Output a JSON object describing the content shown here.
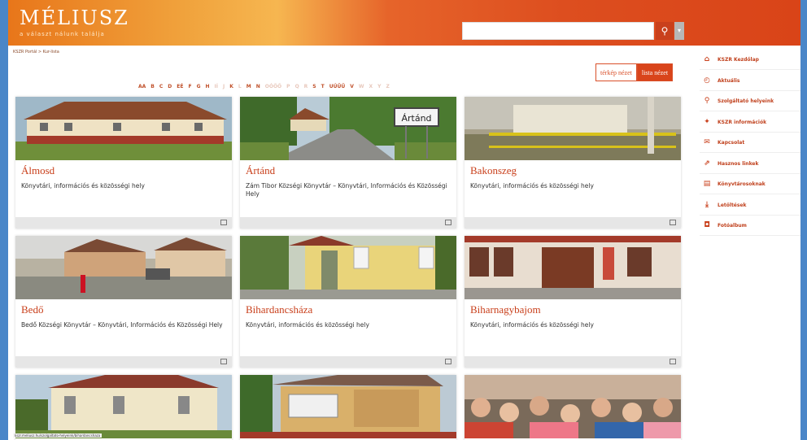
{
  "header": {
    "logo_title": "MÉLIUSZ",
    "logo_subtitle": "a választ nálunk találja",
    "search_placeholder": "",
    "search_icon": "search-icon",
    "dropdown_icon": "chevron-down-icon"
  },
  "breadcrumb": "KSZR Portál > Kur-lista",
  "view_toggle": {
    "map": "térkép nézet",
    "list": "lista nézet"
  },
  "alphabet": [
    {
      "l": "AA",
      "on": true
    },
    {
      "l": "B",
      "on": true
    },
    {
      "l": "C",
      "on": true
    },
    {
      "l": "D",
      "on": true
    },
    {
      "l": "EÉ",
      "on": true
    },
    {
      "l": "F",
      "on": true
    },
    {
      "l": "G",
      "on": true
    },
    {
      "l": "H",
      "on": true
    },
    {
      "l": "IÍ",
      "on": false
    },
    {
      "l": "J",
      "on": false
    },
    {
      "l": "K",
      "on": true
    },
    {
      "l": "L",
      "on": false
    },
    {
      "l": "M",
      "on": true
    },
    {
      "l": "N",
      "on": true
    },
    {
      "l": "OÓÖŐ",
      "on": false
    },
    {
      "l": "P",
      "on": false
    },
    {
      "l": "Q",
      "on": false
    },
    {
      "l": "R",
      "on": false
    },
    {
      "l": "S",
      "on": true
    },
    {
      "l": "T",
      "on": true
    },
    {
      "l": "UÚÜŰ",
      "on": true
    },
    {
      "l": "V",
      "on": true
    },
    {
      "l": "W",
      "on": false
    },
    {
      "l": "X",
      "on": false
    },
    {
      "l": "Y",
      "on": false
    },
    {
      "l": "Z",
      "on": false
    }
  ],
  "cards": [
    {
      "name": "Álmosd",
      "desc": "Könyvtári, információs és közösségi hely"
    },
    {
      "name": "Ártánd",
      "desc": "Zám Tibor Községi Könyvtár – Könyvtári, Információs és Közösségi Hely",
      "sign": "Ártánd"
    },
    {
      "name": "Bakonszeg",
      "desc": "Könyvtári, információs és közösségi hely"
    },
    {
      "name": "Bedő",
      "desc": "Bedő Községi Könyvtár – Könyvtári, Információs és Közösségi Hely"
    },
    {
      "name": "Bihardancsháza",
      "desc": "Könyvtári, információs és közösségi hely"
    },
    {
      "name": "Biharnagybajom",
      "desc": "Könyvtári, információs és közösségi hely"
    }
  ],
  "sidebar": {
    "items": [
      {
        "label": "KSZR Kezdőlap",
        "icon": "home-icon"
      },
      {
        "label": "Aktuális",
        "icon": "clock-icon"
      },
      {
        "label": "Szolgáltató helyeink",
        "icon": "search-icon"
      },
      {
        "label": "KSZR információk",
        "icon": "puzzle-icon"
      },
      {
        "label": "Kapcsolat",
        "icon": "mail-icon"
      },
      {
        "label": "Hasznos linkek",
        "icon": "external-link-icon"
      },
      {
        "label": "Könyvtárosoknak",
        "icon": "book-icon"
      },
      {
        "label": "Letöltések",
        "icon": "download-icon"
      },
      {
        "label": "Fotóalbum",
        "icon": "camera-icon"
      }
    ]
  },
  "status_url": "kszr.meliusz.hu/szolgaltato-helyeink/bihardancshaza"
}
